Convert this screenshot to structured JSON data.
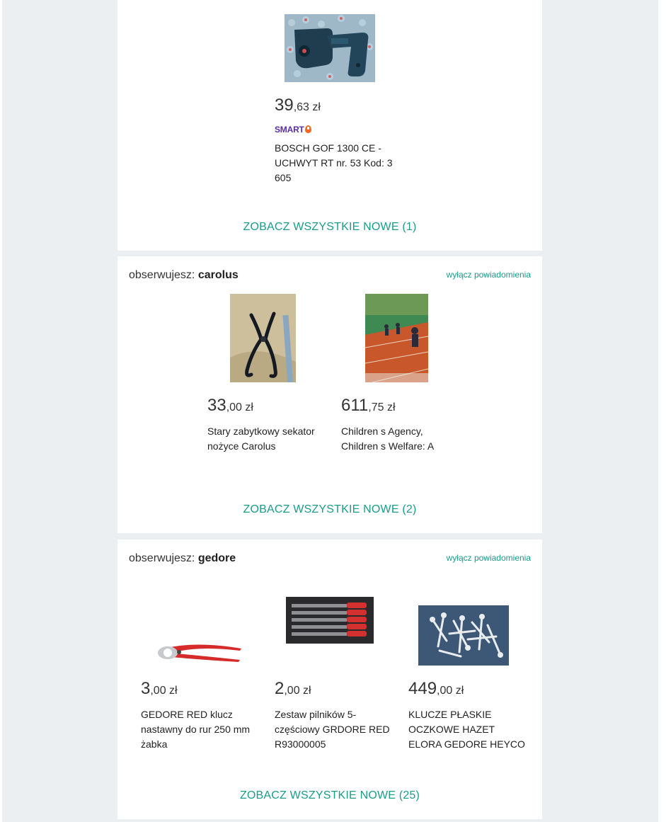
{
  "colors": {
    "accent": "#1a9c8a",
    "smart_purple": "#5a2ea6",
    "smart_orange": "#f56a1c"
  },
  "sections": [
    {
      "items": [
        {
          "price_int": "39",
          "price_rest": ",63 zł",
          "badge": "SMART",
          "title": "BOSCH GOF 1300 CE - UCHWYT RT nr. 53 Kod: 3 605",
          "image": "bosch-handle-photo"
        }
      ],
      "see_all": "ZOBACZ WSZYSTKIE NOWE (1)"
    },
    {
      "follow_prefix": "obserwujesz: ",
      "follow_name": "carolus",
      "unsubscribe": "wyłącz powiadomienia",
      "items": [
        {
          "price_int": "33",
          "price_rest": ",00 zł",
          "title": "Stary zabytkowy sekator nożyce Carolus",
          "image": "pruner-photo"
        },
        {
          "price_int": "611",
          "price_rest": ",75 zł",
          "title": "Children s Agency, Children s Welfare: A",
          "image": "book-cover"
        }
      ],
      "see_all": "ZOBACZ WSZYSTKIE NOWE (2)"
    },
    {
      "follow_prefix": "obserwujesz: ",
      "follow_name": "gedore",
      "unsubscribe": "wyłącz powiadomienia",
      "items": [
        {
          "price_int": "3",
          "price_rest": ",00 zł",
          "title": "GEDORE RED klucz nastawny do rur 250 mm żabka",
          "image": "pliers-photo"
        },
        {
          "price_int": "2",
          "price_rest": ",00 zł",
          "title": "Zestaw pilników 5-częściowy GRDORE RED R93000005",
          "image": "files-set-photo"
        },
        {
          "price_int": "449",
          "price_rest": ",00 zł",
          "title": "KLUCZE PŁASKIE OCZKOWE HAZET ELORA GEDORE HEYCO",
          "image": "wrenches-photo"
        }
      ],
      "see_all": "ZOBACZ WSZYSTKIE NOWE (25)"
    }
  ]
}
